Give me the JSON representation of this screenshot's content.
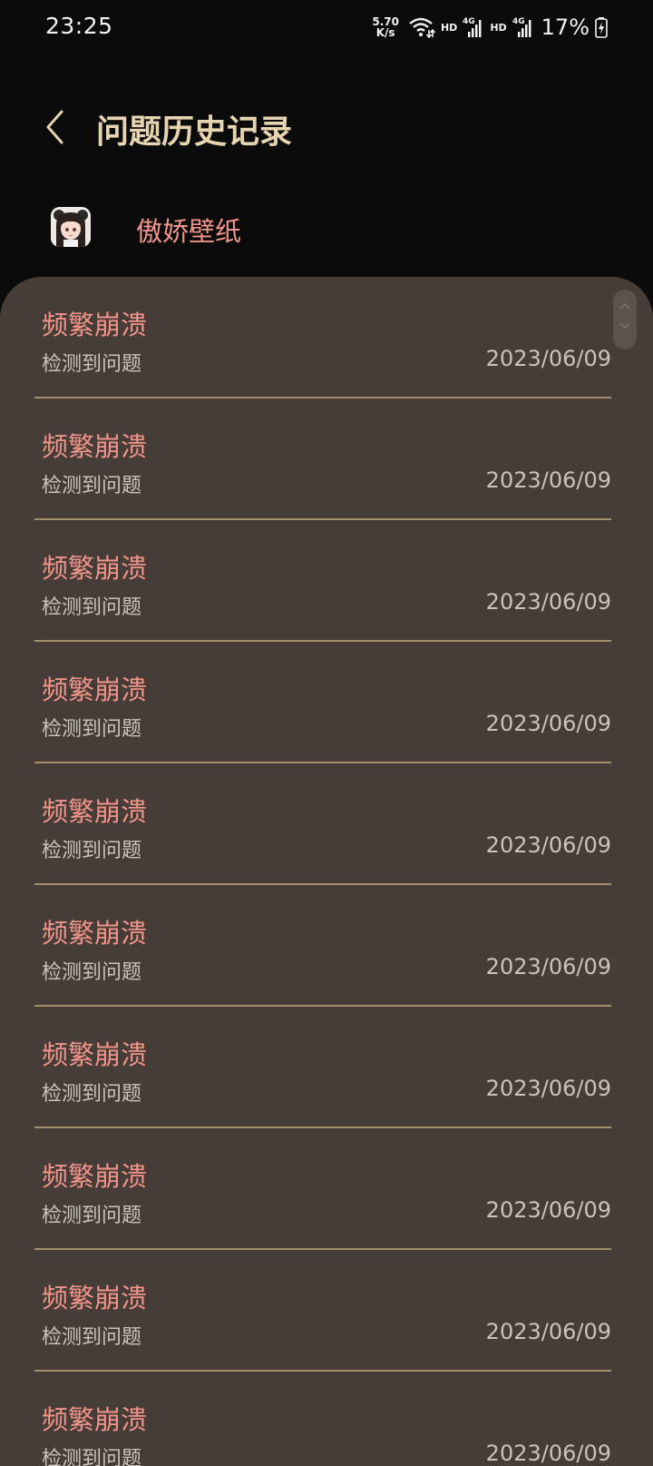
{
  "status_bar": {
    "time": "23:25",
    "net_speed_value": "5.70",
    "net_speed_unit": "K/s",
    "hd_1": "HD",
    "hd_2": "HD",
    "battery": "17%"
  },
  "header": {
    "title": "问题历史记录"
  },
  "app": {
    "name": "傲娇壁纸"
  },
  "colors": {
    "background": "#0b0b0b",
    "card": "#463d38",
    "title": "#e6d5ae",
    "accent_text": "#f1948a",
    "secondary_text": "#c9c3bd",
    "divider": "#a38f6b"
  },
  "problems": [
    {
      "title": "频繁崩溃",
      "subtitle": "检测到问题",
      "date": "2023/06/09"
    },
    {
      "title": "频繁崩溃",
      "subtitle": "检测到问题",
      "date": "2023/06/09"
    },
    {
      "title": "频繁崩溃",
      "subtitle": "检测到问题",
      "date": "2023/06/09"
    },
    {
      "title": "频繁崩溃",
      "subtitle": "检测到问题",
      "date": "2023/06/09"
    },
    {
      "title": "频繁崩溃",
      "subtitle": "检测到问题",
      "date": "2023/06/09"
    },
    {
      "title": "频繁崩溃",
      "subtitle": "检测到问题",
      "date": "2023/06/09"
    },
    {
      "title": "频繁崩溃",
      "subtitle": "检测到问题",
      "date": "2023/06/09"
    },
    {
      "title": "频繁崩溃",
      "subtitle": "检测到问题",
      "date": "2023/06/09"
    },
    {
      "title": "频繁崩溃",
      "subtitle": "检测到问题",
      "date": "2023/06/09"
    },
    {
      "title": "频繁崩溃",
      "subtitle": "检测到问题",
      "date": "2023/06/09"
    }
  ]
}
